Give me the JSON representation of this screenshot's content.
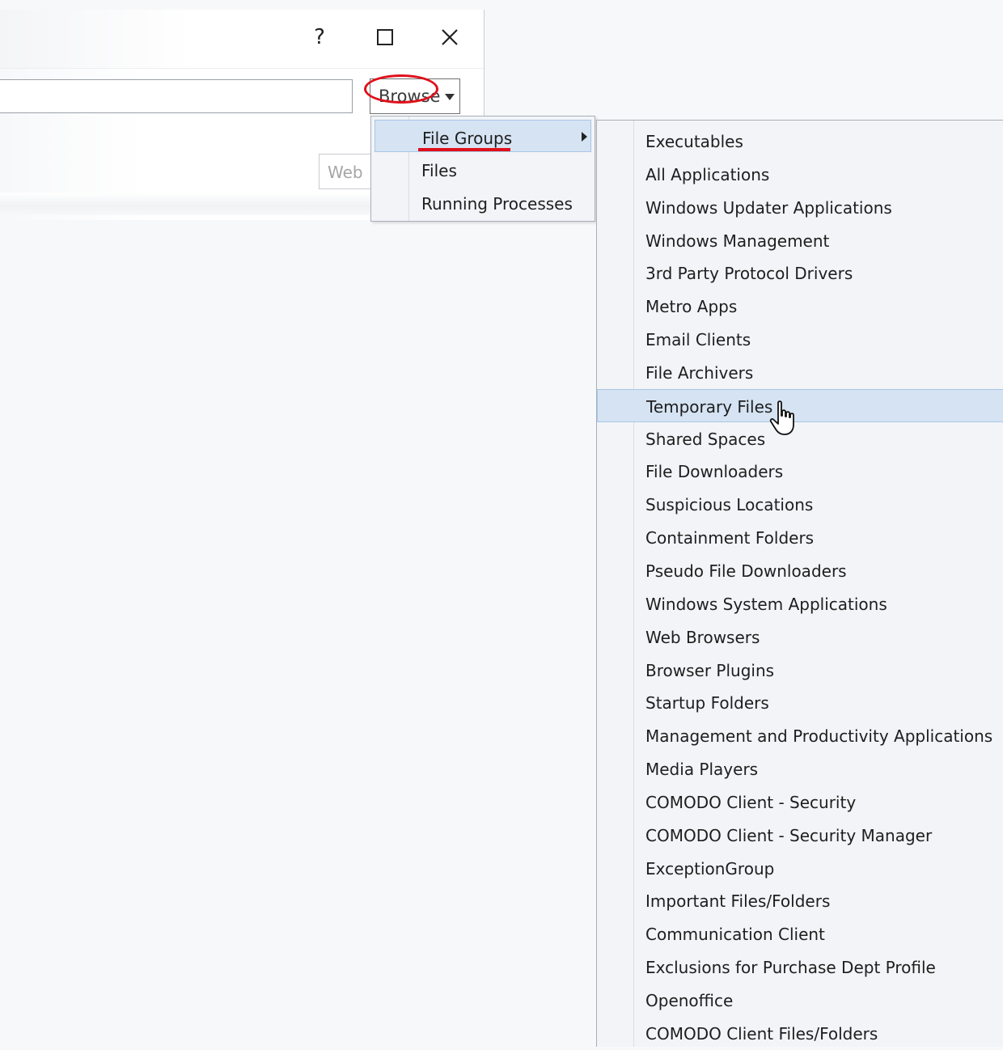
{
  "dialog": {
    "help_icon": "?",
    "path_input_value": "",
    "browse_label": "Browse",
    "web_label": "Web"
  },
  "menu": {
    "items": [
      {
        "label": "File Groups",
        "highlighted": true,
        "has_submenu": true
      },
      {
        "label": "Files"
      },
      {
        "label": "Running Processes"
      }
    ]
  },
  "submenu": {
    "items": [
      "Executables",
      "All Applications",
      "Windows Updater Applications",
      "Windows Management",
      "3rd Party Protocol Drivers",
      "Metro Apps",
      "Email Clients",
      "File Archivers",
      "Temporary Files",
      "Shared Spaces",
      "File Downloaders",
      "Suspicious Locations",
      "Containment Folders",
      "Pseudo File Downloaders",
      "Windows System Applications",
      "Web Browsers",
      "Browser Plugins",
      "Startup Folders",
      "Management and Productivity Applications",
      "Media Players",
      "COMODO Client - Security",
      "COMODO Client - Security Manager",
      "ExceptionGroup",
      "Important Files/Folders",
      "Communication Client",
      "Exclusions for Purchase Dept Profile",
      "Openoffice",
      "COMODO Client Files/Folders"
    ],
    "highlighted": "Temporary Files"
  },
  "colors": {
    "annotation_red": "#e0101a",
    "highlight_bg": "#d5e3f3",
    "menu_bg": "#f2f4f7"
  },
  "icons": [
    "help-icon",
    "maximize-icon",
    "close-icon",
    "dropdown-arrow-icon",
    "submenu-arrow-icon",
    "hand-pointer-icon"
  ]
}
